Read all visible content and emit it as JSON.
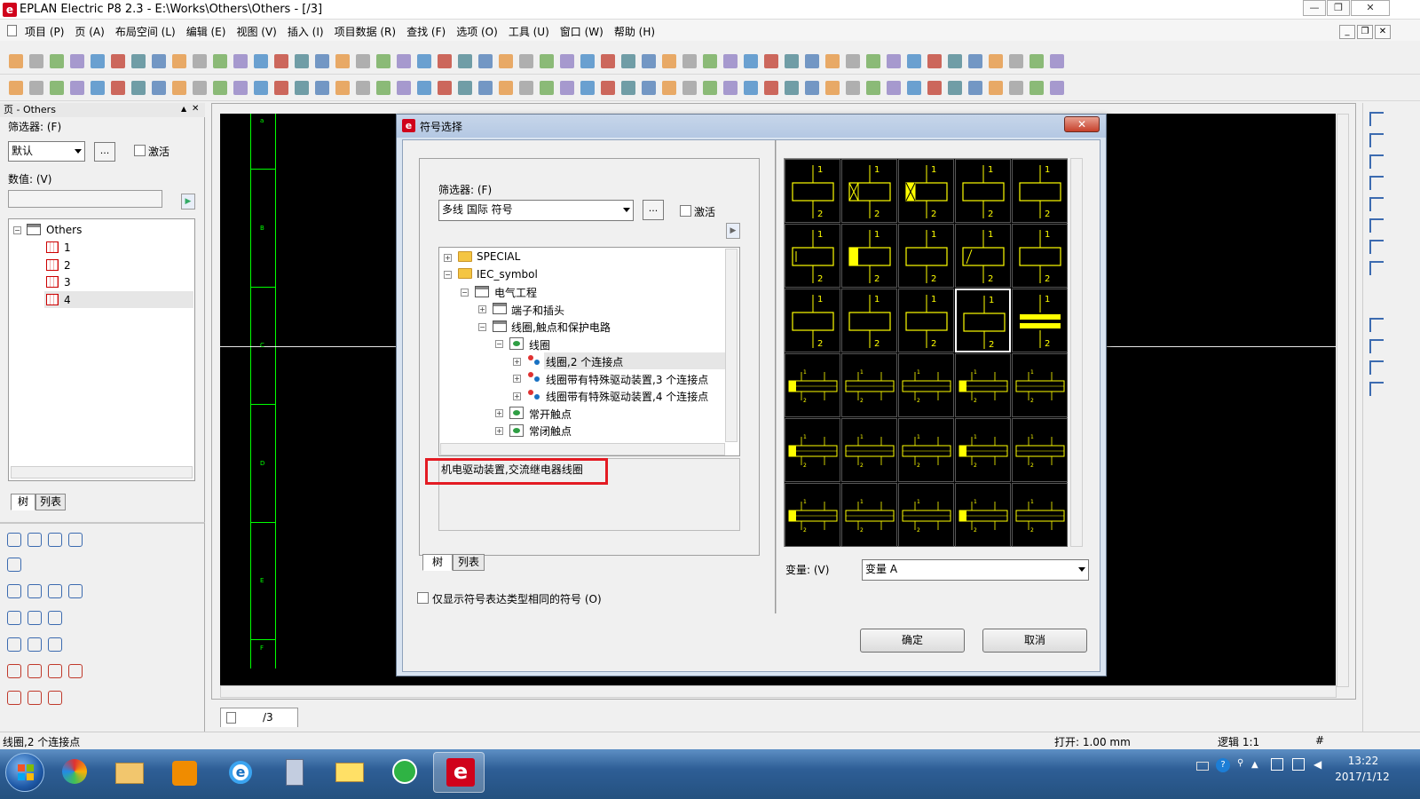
{
  "window": {
    "title": "EPLAN Electric P8 2.3 - E:\\Works\\Others\\Others - [/3]",
    "btn_minimize": "—",
    "btn_restore": "❐",
    "btn_close": "✕"
  },
  "menubar": {
    "items": [
      "项目 (P)",
      "页 (A)",
      "布局空间 (L)",
      "编辑 (E)",
      "视图 (V)",
      "插入 (I)",
      "项目数据 (R)",
      "查找 (F)",
      "选项 (O)",
      "工具 (U)",
      "窗口 (W)",
      "帮助 (H)"
    ]
  },
  "left_panel": {
    "header": "页 - Others",
    "filter_label": "筛选器: (F)",
    "filter_value": "默认",
    "ellipsis": "...",
    "activate_label": "激活",
    "value_label": "数值: (V)",
    "value_input": "",
    "tree_root": "Others",
    "pages": [
      "1",
      "2",
      "3",
      "4"
    ],
    "tab_tree": "树",
    "tab_list": "列表"
  },
  "canvas": {
    "row_labels": [
      "B",
      "C",
      "D",
      "E",
      "F"
    ],
    "tab_label": "/3"
  },
  "dialog": {
    "title": "符号选择",
    "close": "✕",
    "filter_label": "筛选器: (F)",
    "filter_value": "多线 国际 符号",
    "ellipsis": "...",
    "activate_label": "激活",
    "tree": {
      "special": "SPECIAL",
      "iec": "IEC_symbol",
      "elec": "电气工程",
      "terminals": "端子和插头",
      "coils_contacts": "线圈,触点和保护电路",
      "coil": "线圈",
      "coil_2": "线圈,2 个连接点",
      "coil_3": "线圈带有特殊驱动装置,3 个连接点",
      "coil_4": "线圈带有特殊驱动装置,4 个连接点",
      "no_contact": "常开触点",
      "nc_contact": "常闭触点"
    },
    "description": "机电驱动装置,交流继电器线圈",
    "tab_tree": "树",
    "tab_list": "列表",
    "only_same_type": "仅显示符号表达类型相同的符号 (O)",
    "variant_label": "变量: (V)",
    "variant_value": "变量 A",
    "ok": "确定",
    "cancel": "取消",
    "pin_top": "1",
    "pin_bottom": "2"
  },
  "statusbar": {
    "left": "线圈,2 个连接点",
    "open": "打开: 1.00 mm",
    "logic": "逻辑 1:1",
    "hash": "#"
  },
  "taskbar": {
    "time": "13:22",
    "date": "2017/1/12"
  },
  "colors": {
    "canvas_bg": "#000000",
    "grid_green": "#00ff00",
    "symbol_yellow": "#ffff00",
    "highlight_red": "#e31b23"
  }
}
